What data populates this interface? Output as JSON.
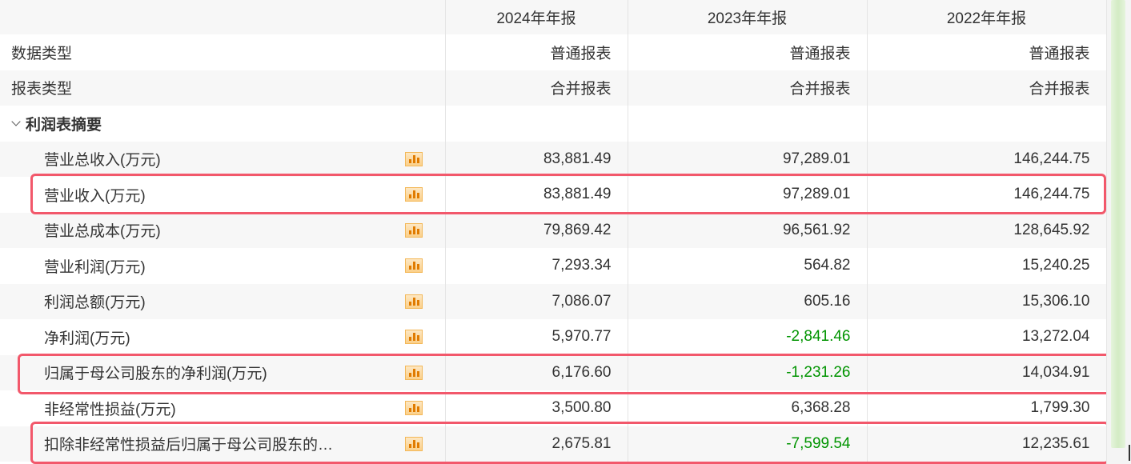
{
  "header": {
    "col1": "2024年年报",
    "col2": "2023年年报",
    "col3": "2022年年报"
  },
  "meta_rows": [
    {
      "label": "数据类型",
      "v1": "普通报表",
      "v2": "普通报表",
      "v3": "普通报表"
    },
    {
      "label": "报表类型",
      "v1": "合并报表",
      "v2": "合并报表",
      "v3": "合并报表"
    }
  ],
  "section": {
    "label": "利润表摘要",
    "icon": "chevron-down-icon"
  },
  "rows": [
    {
      "label": "营业总收入(万元)",
      "v1": "83,881.49",
      "v2": "97,289.01",
      "v3": "146,244.75"
    },
    {
      "label": "营业收入(万元)",
      "v1": "83,881.49",
      "v2": "97,289.01",
      "v3": "146,244.75"
    },
    {
      "label": "营业总成本(万元)",
      "v1": "79,869.42",
      "v2": "96,561.92",
      "v3": "128,645.92"
    },
    {
      "label": "营业利润(万元)",
      "v1": "7,293.34",
      "v2": "564.82",
      "v3": "15,240.25"
    },
    {
      "label": "利润总额(万元)",
      "v1": "7,086.07",
      "v2": "605.16",
      "v3": "15,306.10"
    },
    {
      "label": "净利润(万元)",
      "v1": "5,970.77",
      "v2": "-2,841.46",
      "v3": "13,272.04"
    },
    {
      "label": "归属于母公司股东的净利润(万元)",
      "v1": "6,176.60",
      "v2": "-1,231.26",
      "v3": "14,034.91"
    },
    {
      "label": "非经常性损益(万元)",
      "v1": "3,500.80",
      "v2": "6,368.28",
      "v3": "1,799.30"
    },
    {
      "label": "扣除非经常性损益后归属于母公司股东的…",
      "v1": "2,675.81",
      "v2": "-7,599.54",
      "v3": "12,235.61"
    }
  ],
  "colors": {
    "negative": "#009400",
    "highlight": "#f2586b",
    "band": "#f7f7f7"
  }
}
